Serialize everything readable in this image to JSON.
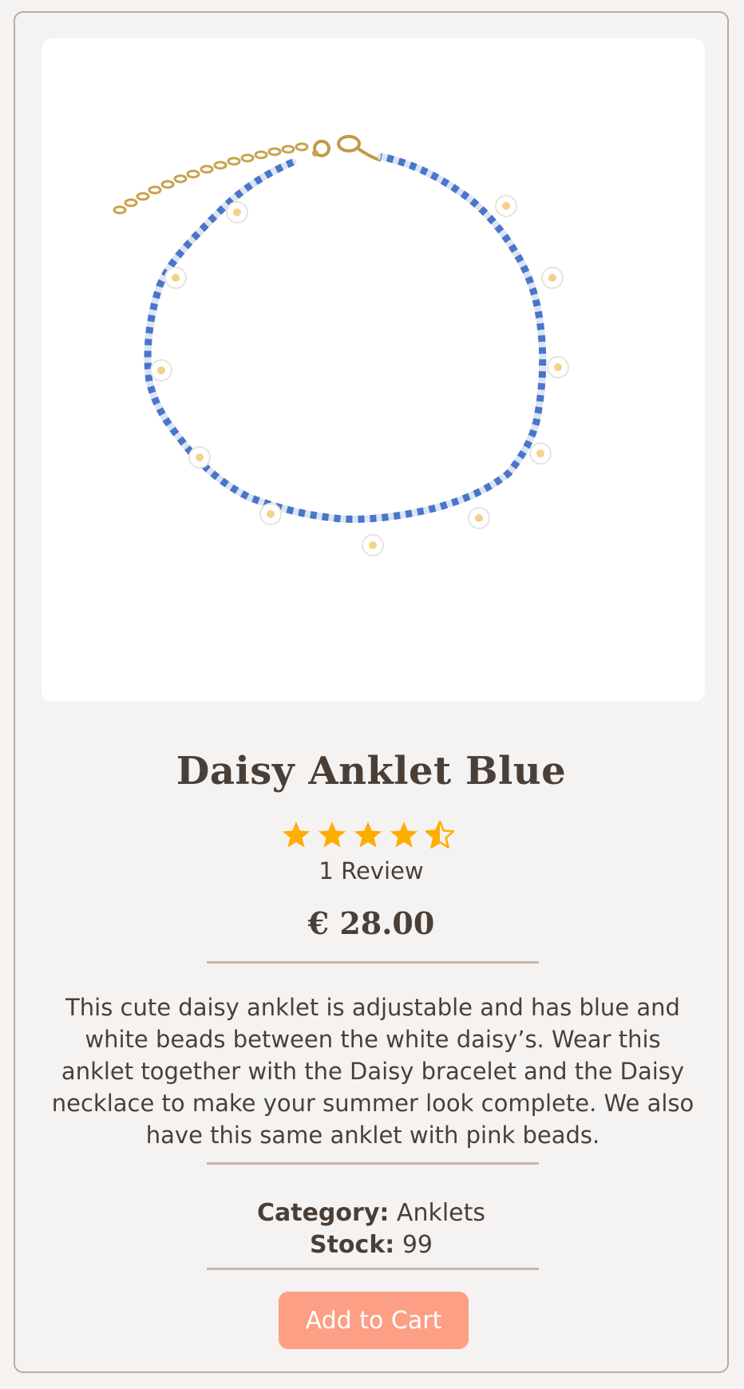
{
  "product": {
    "image_alt": "Daisy Anklet Blue product photo",
    "title": "Daisy Anklet Blue",
    "rating": 4.5,
    "rating_max": 5,
    "reviews_label": "1 Review",
    "price": "€ 28.00",
    "description": "This cute daisy anklet is adjustable and has blue and white beads between the white daisy’s. Wear this anklet together with the Daisy bracelet and the Daisy necklace to make your summer look complete. We also have this same anklet with pink beads.",
    "category_label": "Category:",
    "category_value": "Anklets",
    "stock_label": "Stock:",
    "stock_value": "99",
    "add_to_cart_label": "Add to Cart"
  },
  "colors": {
    "text": "#4a3f37",
    "star": "#ffad00",
    "button": "#fc9f85",
    "divider": "#c9b6a9",
    "background": "#f5f3f1"
  },
  "icons": {
    "rating": "star-icon"
  }
}
